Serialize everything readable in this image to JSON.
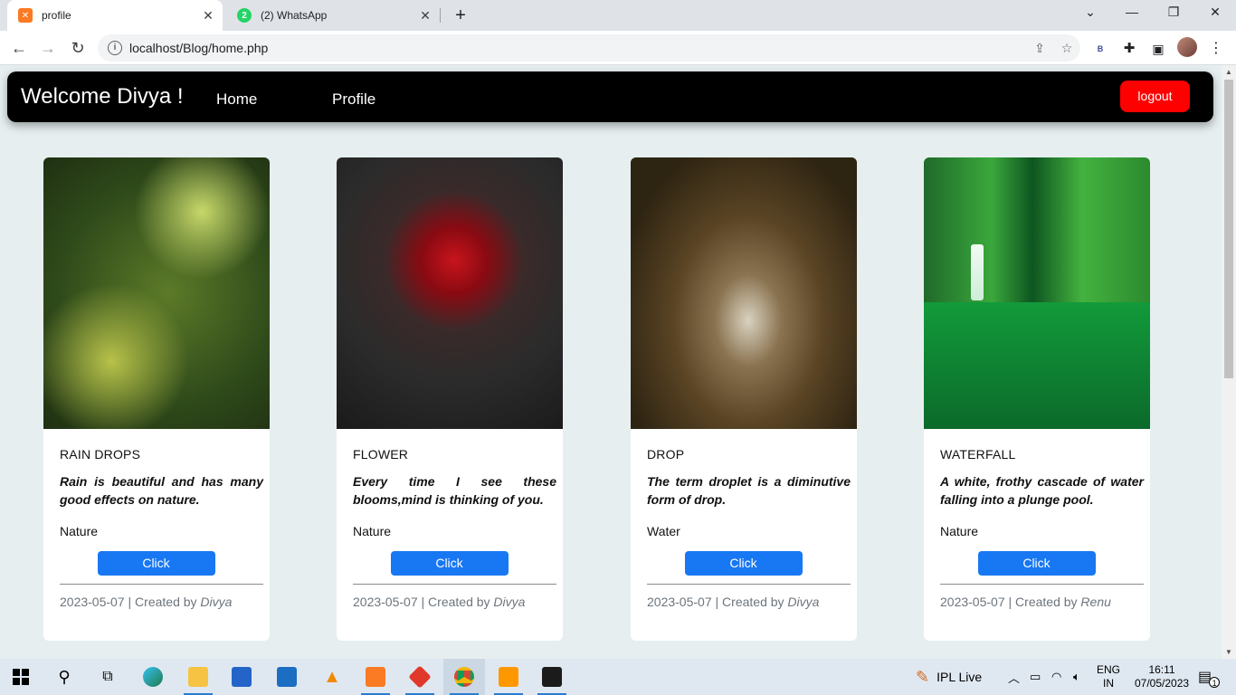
{
  "browser": {
    "tabs": [
      {
        "title": "profile",
        "favicon": "xampp-icon",
        "active": true
      },
      {
        "title": "(2) WhatsApp",
        "favicon": "whatsapp-icon",
        "active": false
      }
    ],
    "address": "localhost/Blog/home.php",
    "profile_badge": "B"
  },
  "navbar": {
    "welcome": "Welcome Divya !",
    "links": [
      "Home",
      "Profile"
    ],
    "logout_label": "logout"
  },
  "cards": [
    {
      "title": "RAIN DROPS",
      "description": "Rain is beautiful and has many good effects on nature.",
      "category": "Nature",
      "button": "Click",
      "date": "2023-05-07",
      "created_prefix": "| Created by",
      "author": "Divya"
    },
    {
      "title": "FLOWER",
      "description": "Every time I see these blooms,mind is thinking of you.",
      "category": "Nature",
      "button": "Click",
      "date": "2023-05-07",
      "created_prefix": "| Created by",
      "author": "Divya"
    },
    {
      "title": "DROP",
      "description": "The term droplet is a diminutive form of drop.",
      "category": "Water",
      "button": "Click",
      "date": "2023-05-07",
      "created_prefix": "| Created by",
      "author": "Divya"
    },
    {
      "title": "WATERFALL",
      "description": "A white, frothy cascade of water falling into a plunge pool.",
      "category": "Nature",
      "button": "Click",
      "date": "2023-05-07",
      "created_prefix": "| Created by",
      "author": "Renu"
    }
  ],
  "taskbar": {
    "weather_label": "IPL Live",
    "language": "ENG",
    "region": "IN",
    "time": "16:11",
    "date": "07/05/2023",
    "notification_count": "1"
  },
  "colors": {
    "navbar_bg": "#000000",
    "logout_bg": "#ff0000",
    "click_button_bg": "#1877f2",
    "page_bg": "#e6eef0"
  }
}
